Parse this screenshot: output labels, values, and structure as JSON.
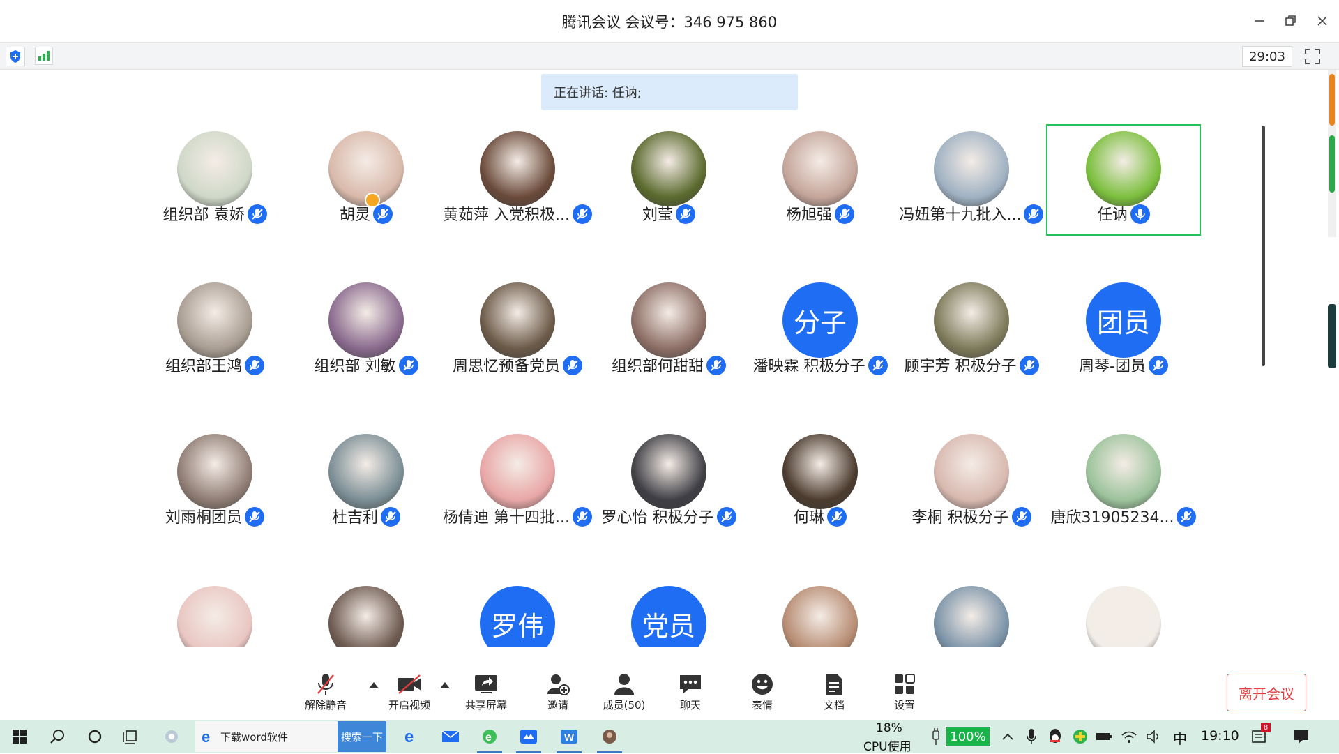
{
  "window": {
    "title": "腾讯会议 会议号：346 975 860",
    "minimize_icon": "minimize-icon",
    "restore_icon": "restore-icon",
    "close_icon": "close-icon"
  },
  "statusbar": {
    "timer": "29:03",
    "security_icon": "shield-icon",
    "signal_icon": "signal-bars-icon",
    "fullscreen_icon": "fullscreen-icon"
  },
  "speaking_banner": "正在讲话: 任讷;",
  "participants": [
    {
      "name": "组织部 袁娇",
      "avatar": "photo",
      "color": "#cfd8c8"
    },
    {
      "name": "胡灵",
      "avatar": "photo",
      "color": "#d9b9aa",
      "host": true
    },
    {
      "name": "黄茹萍 入党积极...",
      "avatar": "photo",
      "color": "#6a4a3a"
    },
    {
      "name": "刘莹",
      "avatar": "photo",
      "color": "#5b6a2e"
    },
    {
      "name": "杨旭强",
      "avatar": "photo",
      "color": "#c4a59a"
    },
    {
      "name": "冯妞第十九批入...",
      "avatar": "photo",
      "color": "#9fb1c2"
    },
    {
      "name": "任讷",
      "avatar": "photo",
      "color": "#7bbf3d",
      "active": true
    },
    {
      "name": "组织部王鸿",
      "avatar": "photo",
      "color": "#a99d92"
    },
    {
      "name": "组织部 刘敏",
      "avatar": "photo",
      "color": "#8a6a8e"
    },
    {
      "name": "周思忆预备党员",
      "avatar": "photo",
      "color": "#6b5a48"
    },
    {
      "name": "组织部何甜甜",
      "avatar": "photo",
      "color": "#8d6f66"
    },
    {
      "name": "潘映霖 积极分子",
      "avatar": "text",
      "text": "分子"
    },
    {
      "name": "顾宇芳 积极分子",
      "avatar": "photo",
      "color": "#7d7a5a"
    },
    {
      "name": "周琴-团员",
      "avatar": "text",
      "text": "团员"
    },
    {
      "name": "刘雨桐团员",
      "avatar": "photo",
      "color": "#8f7d74"
    },
    {
      "name": "杜吉利",
      "avatar": "photo",
      "color": "#7b8e95"
    },
    {
      "name": "杨倩迪 第十四批...",
      "avatar": "photo",
      "color": "#e8a6a6"
    },
    {
      "name": "罗心怡 积极分子",
      "avatar": "photo",
      "color": "#3e3e44"
    },
    {
      "name": "何琳",
      "avatar": "photo",
      "color": "#4b3b2e"
    },
    {
      "name": "李桐 积极分子",
      "avatar": "photo",
      "color": "#d8b9b0"
    },
    {
      "name": "唐欣31905234...",
      "avatar": "photo",
      "color": "#9cc39b"
    },
    {
      "name": "",
      "avatar": "photo",
      "color": "#e9c6c2"
    },
    {
      "name": "",
      "avatar": "photo",
      "color": "#6d5a50"
    },
    {
      "name": "",
      "avatar": "text",
      "text": "罗伟"
    },
    {
      "name": "",
      "avatar": "text",
      "text": "党员"
    },
    {
      "name": "",
      "avatar": "photo",
      "color": "#b78c72"
    },
    {
      "name": "",
      "avatar": "photo",
      "color": "#7b93a8"
    },
    {
      "name": "",
      "avatar": "photo",
      "color": "#f3ede8"
    }
  ],
  "toolbar": [
    {
      "label": "解除静音",
      "icon": "mic-muted-icon"
    },
    {
      "label": "开启视频",
      "icon": "video-off-icon"
    },
    {
      "label": "共享屏幕",
      "icon": "share-screen-icon"
    },
    {
      "label": "邀请",
      "icon": "invite-icon"
    },
    {
      "label": "成员(50)",
      "icon": "members-icon"
    },
    {
      "label": "聊天",
      "icon": "chat-icon"
    },
    {
      "label": "表情",
      "icon": "emoji-icon"
    },
    {
      "label": "文档",
      "icon": "document-icon"
    },
    {
      "label": "设置",
      "icon": "settings-icon"
    }
  ],
  "leave_button": "离开会议",
  "taskbar": {
    "app_label": "下载word软件",
    "search_button": "搜索一下",
    "cpu_percent": "18%",
    "cpu_label": "CPU使用",
    "battery": "100%",
    "ime": "中",
    "clock": "19:10",
    "notification_count": "8"
  }
}
